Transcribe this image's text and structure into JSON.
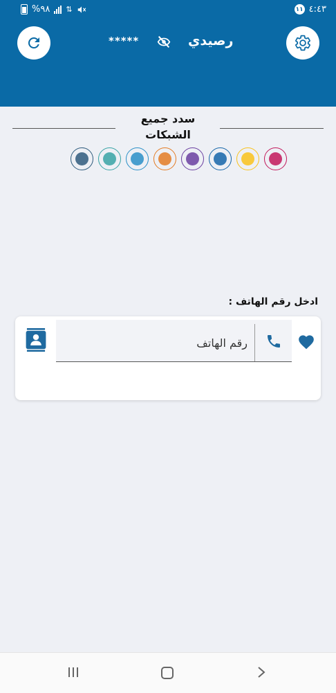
{
  "status_bar": {
    "time": "٤:٤٣",
    "notification_count": "١١",
    "battery": "%٩٨"
  },
  "header": {
    "title": "رصيدي",
    "masked_balance": "*****",
    "refresh_icon": "refresh-icon",
    "settings_icon": "gear-icon",
    "visibility_icon": "eye-off-icon"
  },
  "networks": {
    "title_line1": "سدد جميع",
    "title_line2": "الشبكات",
    "logos": [
      {
        "name": "network-logo-1",
        "text": "",
        "color": "#c2185b"
      },
      {
        "name": "network-logo-2",
        "text": "",
        "color": "#f9c21b"
      },
      {
        "name": "network-logo-3",
        "text": "",
        "color": "#1565a9"
      },
      {
        "name": "network-logo-4",
        "text": "",
        "color": "#6a3fa0"
      },
      {
        "name": "network-logo-5",
        "text": "",
        "color": "#e37b24"
      },
      {
        "name": "network-logo-6",
        "text": "",
        "color": "#2a8fc7"
      },
      {
        "name": "network-logo-7",
        "text": "",
        "color": "#37a3a5"
      },
      {
        "name": "network-logo-8",
        "text": "",
        "color": "#2f5b7d"
      }
    ]
  },
  "phone_section": {
    "label": "ادخل رقم الهاتف :",
    "placeholder": "رقم الهاتف"
  },
  "colors": {
    "primary": "#0a6aa6",
    "background": "#eef0f5"
  }
}
